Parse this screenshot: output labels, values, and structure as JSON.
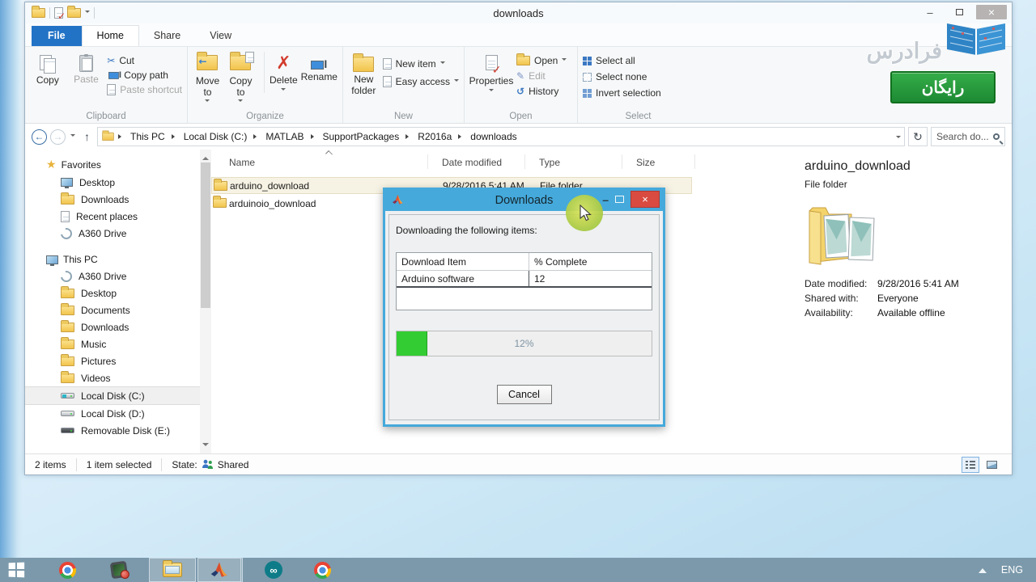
{
  "explorer": {
    "title": "downloads",
    "controls": {
      "minimize": "–",
      "close": "×"
    },
    "tabs": {
      "file": "File",
      "home": "Home",
      "share": "Share",
      "view": "View"
    },
    "ribbon": {
      "clipboard": {
        "group": "Clipboard",
        "copy": "Copy",
        "paste": "Paste",
        "cut": "Cut",
        "copy_path": "Copy path",
        "paste_shortcut": "Paste shortcut"
      },
      "organize": {
        "group": "Organize",
        "move_to": "Move to",
        "copy_to": "Copy to",
        "del": "Delete",
        "rename": "Rename"
      },
      "new_group": {
        "group": "New",
        "new_folder": "New folder",
        "new_item": "New item",
        "easy_access": "Easy access"
      },
      "open_group": {
        "group": "Open",
        "properties": "Properties",
        "open": "Open",
        "edit": "Edit",
        "history": "History"
      },
      "select_group": {
        "group": "Select",
        "select_all": "Select all",
        "select_none": "Select none",
        "invert_selection": "Invert selection"
      }
    },
    "address": {
      "crumbs": [
        "This PC",
        "Local Disk (C:)",
        "MATLAB",
        "SupportPackages",
        "R2016a",
        "downloads"
      ],
      "search_placeholder": "Search do..."
    },
    "sidebar": {
      "favorites": {
        "label": "Favorites",
        "items": [
          "Desktop",
          "Downloads",
          "Recent places",
          "A360 Drive"
        ]
      },
      "this_pc": {
        "label": "This PC",
        "items": [
          "A360 Drive",
          "Desktop",
          "Documents",
          "Downloads",
          "Music",
          "Pictures",
          "Videos",
          "Local Disk (C:)",
          "Local Disk (D:)",
          "Removable Disk (E:)"
        ]
      }
    },
    "filelist": {
      "columns": [
        "Name",
        "Date modified",
        "Type",
        "Size"
      ],
      "rows": [
        {
          "name": "arduino_download",
          "date": "9/28/2016 5:41 AM",
          "type": "File folder"
        },
        {
          "name": "arduinoio_download",
          "date": "",
          "type": ""
        }
      ]
    },
    "details": {
      "title": "arduino_download",
      "subtitle": "File folder",
      "fields": [
        {
          "label": "Date modified:",
          "value": "9/28/2016 5:41 AM"
        },
        {
          "label": "Shared with:",
          "value": "Everyone"
        },
        {
          "label": "Availability:",
          "value": "Available offline"
        }
      ]
    },
    "statusbar": {
      "count": "2 items",
      "selected": "1 item selected",
      "state_label": "State:",
      "state_value": "Shared"
    }
  },
  "dialog": {
    "title": "Downloads",
    "message": "Downloading the following items:",
    "table": {
      "col_item": "Download Item",
      "col_complete": "% Complete",
      "row_item": "Arduino software",
      "row_complete": "12"
    },
    "progress": {
      "percent": 12,
      "label": "12%"
    },
    "cancel_label": "Cancel"
  },
  "watermark": {
    "brand": "فرادرس",
    "badge": "رایگان"
  },
  "taskbar": {
    "language": "ENG"
  },
  "icons": {
    "back": "←",
    "forward": "→",
    "up": "↑",
    "refresh": "↻",
    "cut": "✂",
    "delete": "✗",
    "edit": "✎",
    "history": "↺",
    "check": "✓",
    "star": "★",
    "infinity": "∞"
  },
  "colors": {
    "accent_blue": "#45a9db",
    "progress_green": "#33cc33",
    "badge_green": "#1f8a33",
    "close_red": "#d94b40",
    "taskbar": "#7b99ab"
  }
}
